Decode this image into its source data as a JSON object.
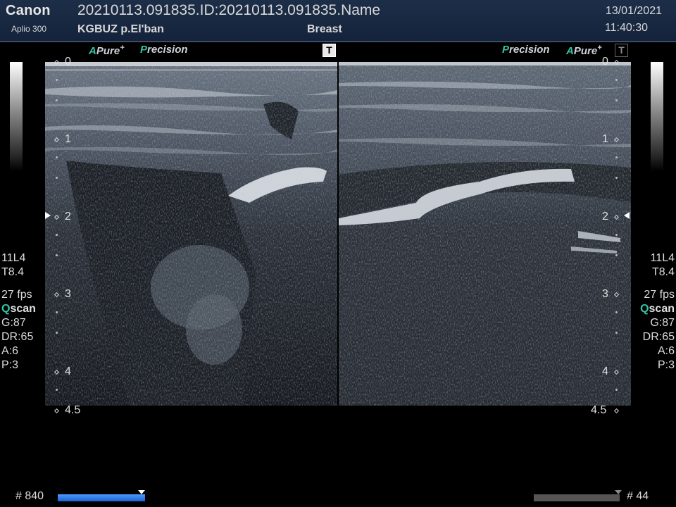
{
  "header": {
    "brand": "Canon",
    "model": "Aplio 300",
    "study": "20210113.091835.ID:20210113.091835.Name",
    "hospital": "KGBUZ p.El'ban",
    "preset": "Breast",
    "date": "13/01/2021",
    "time": "11:40:30"
  },
  "left_badges": {
    "apure_a": "A",
    "apure_text": "Pure",
    "apure_sup": "+",
    "precision_p": "P",
    "precision_text": "recision",
    "t_label": "T"
  },
  "right_badges": {
    "precision_p": "P",
    "precision_text": "recision",
    "apure_a": "A",
    "apure_text": "Pure",
    "apure_sup": "+",
    "t_label": "T"
  },
  "depth_scale": {
    "labels": [
      "0",
      "1",
      "2",
      "3",
      "4",
      "4.5"
    ]
  },
  "left_params": {
    "probe": "11L4",
    "tgc": "T8.4",
    "fps": "27 fps",
    "qscan_q": "Q",
    "qscan_text": "scan",
    "gain": "G:87",
    "dr": "DR:65",
    "a": "A:6",
    "p": "P:3"
  },
  "right_params": {
    "probe": "11L4",
    "tgc": "T8.4",
    "fps": "27 fps",
    "qscan_q": "Q",
    "qscan_text": "scan",
    "gain": "G:87",
    "dr": "DR:65",
    "a": "A:6",
    "p": "P:3"
  },
  "cine": {
    "left_frame": "# 840",
    "right_frame": "# 44"
  },
  "colors": {
    "header_bg": "#1d2e48",
    "accent_green": "#35c3a4",
    "cine_blue": "#1e62d0"
  }
}
